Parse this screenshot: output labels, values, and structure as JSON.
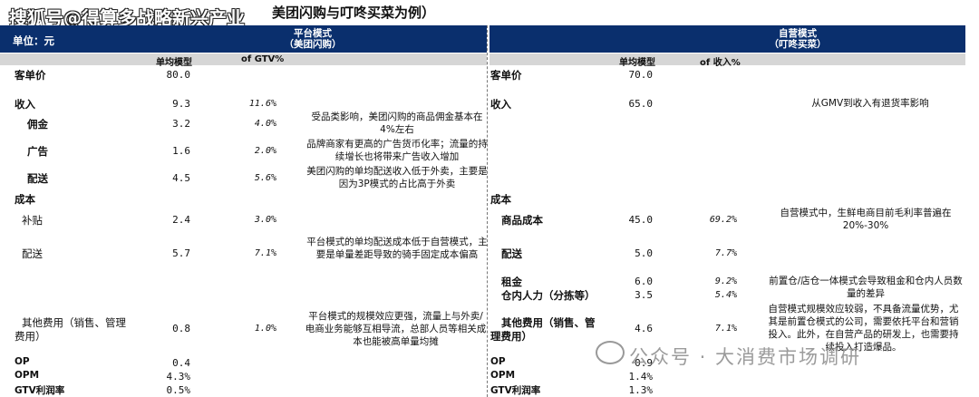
{
  "title": "美团闪购与叮咚买菜为例）",
  "watermarks": {
    "top": "搜狐号@得算多战略新兴产业",
    "bottom": "公众号 · 大消费市场调研"
  },
  "unit_label": "单位：元",
  "left": {
    "header_line1": "平台模式",
    "header_line2": "（美团闪购）",
    "col_model": "单均模型",
    "col_pct": "of GTV%",
    "rows": [
      {
        "label": "客单价",
        "value": "80.0",
        "pct": "",
        "bold": true
      },
      {
        "label": "收入",
        "value": "9.3",
        "pct": "11.6%",
        "bold": true
      },
      {
        "label": "佣金",
        "value": "3.2",
        "pct": "4.0%",
        "bold": true
      },
      {
        "label": "广告",
        "value": "1.6",
        "pct": "2.0%",
        "bold": true
      },
      {
        "label": "配送",
        "value": "4.5",
        "pct": "5.6%",
        "bold": true
      },
      {
        "label": "成本",
        "value": "",
        "pct": "",
        "bold": true
      },
      {
        "label": "补贴",
        "value": "2.4",
        "pct": "3.0%",
        "bold": false
      },
      {
        "label": "配送",
        "value": "5.7",
        "pct": "7.1%",
        "bold": false
      },
      {
        "label_line1": "其他费用（销售、管理",
        "label_line2": "费用）",
        "value": "0.8",
        "pct": "1.0%",
        "bold": false
      },
      {
        "label": "OP",
        "value": "0.4",
        "pct": "",
        "bold": true
      },
      {
        "label": "OPM",
        "value": "4.3%",
        "pct": "",
        "bold": true
      },
      {
        "label": "GTV利润率",
        "value": "0.5%",
        "pct": "",
        "bold": true
      }
    ],
    "notes": [
      "受品类影响，美团闪购的商品佣金基本在4%左右",
      "品牌商家有更高的广告货币化率；流量的持续增长也将带来广告收入增加",
      "美团闪购的单均配送收入低于外卖，主要是因为3P模式的占比高于外卖",
      "平台模式的单均配送成本低于自营模式，主要是单量差距导致的骑手固定成本偏高",
      "平台模式的规模效应更强，流量上与外卖/电商业务能够互相导流，总部人员等相关成本也能被高单量均摊"
    ]
  },
  "right": {
    "header_line1": "自营模式",
    "header_line2": "（叮咚买菜）",
    "col_model": "单均模型",
    "col_pct": "of 收入%",
    "rows": [
      {
        "label": "客单价",
        "value": "70.0",
        "pct": ""
      },
      {
        "label": "收入",
        "value": "65.0",
        "pct": ""
      },
      {
        "label": "成本",
        "value": "",
        "pct": ""
      },
      {
        "label": "商品成本",
        "value": "45.0",
        "pct": "69.2%"
      },
      {
        "label": "配送",
        "value": "5.0",
        "pct": "7.7%"
      },
      {
        "label": "租金",
        "value": "6.0",
        "pct": "9.2%"
      },
      {
        "label": "仓内人力（分拣等）",
        "value": "3.5",
        "pct": "5.4%"
      },
      {
        "label_line1": "其他费用（销售、管",
        "label_line2": "理费用）",
        "value": "4.6",
        "pct": "7.1%"
      },
      {
        "label": "OP",
        "value": "0.9",
        "pct": ""
      },
      {
        "label": "OPM",
        "value": "1.4%",
        "pct": ""
      },
      {
        "label": "GTV利润率",
        "value": "1.3%",
        "pct": ""
      }
    ],
    "notes": [
      "从GMV到收入有退货率影响",
      "自营模式中，生鲜电商目前毛利率普遍在20%-30%",
      "前置仓/店仓一体模式会导致租金和仓内人员数量的差异",
      "自营模式规模效应较弱，不具备流量优势，尤其是前置仓模式的公司，需要依托平台和营销投入。此外，在自营产品的研发上，也需要持续投入打造爆品。"
    ]
  },
  "colors": {
    "header_bg": "#0a2f6d",
    "colhead_bg": "#d6d6d6"
  }
}
